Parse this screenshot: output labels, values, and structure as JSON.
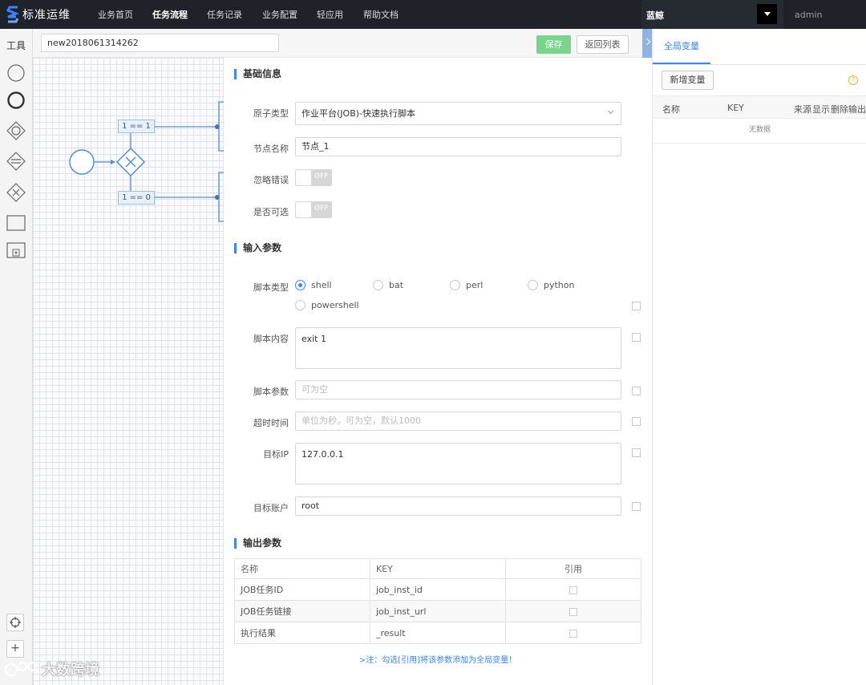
{
  "brand": {
    "name": "标准运维"
  },
  "nav": {
    "items": [
      "业务首页",
      "任务流程",
      "任务记录",
      "业务配置",
      "轻应用",
      "帮助文档"
    ],
    "business": "蓝鲸",
    "user": "admin"
  },
  "toolbar": {
    "title": "工具"
  },
  "header": {
    "flow_name": "new2018061314262",
    "save_label": "保存",
    "back_label": "返回列表"
  },
  "canvas": {
    "cond_top": "1 == 1",
    "cond_bottom": "1 == 0"
  },
  "basic": {
    "title": "基础信息",
    "atom_type_label": "原子类型",
    "atom_type_value": "作业平台(JOB)-快速执行脚本",
    "node_name_label": "节点名称",
    "node_name_value": "节点_1",
    "ignore_error_label": "忽略错误",
    "ignore_error_state": "OFF",
    "optional_label": "是否可选",
    "optional_state": "OFF"
  },
  "input": {
    "title": "输入参数",
    "script_type_label": "脚本类型",
    "script_types": [
      "shell",
      "bat",
      "perl",
      "python",
      "powershell"
    ],
    "selected_script_type": "shell",
    "script_content_label": "脚本内容",
    "script_content_value": "exit 1",
    "script_params_label": "脚本参数",
    "script_params_placeholder": "可为空",
    "timeout_label": "超时时间",
    "timeout_placeholder": "单位为秒，可为空，默认1000",
    "target_ip_label": "目标IP",
    "target_ip_value": "127.0.0.1",
    "target_account_label": "目标账户",
    "target_account_value": "root"
  },
  "output": {
    "title": "输出参数",
    "headers": [
      "名称",
      "KEY",
      "引用"
    ],
    "rows": [
      {
        "name": "JOB任务ID",
        "key": "job_inst_id"
      },
      {
        "name": "JOB任务链接",
        "key": "job_inst_url"
      },
      {
        "name": "执行结果",
        "key": "_result"
      }
    ],
    "note": ">注：勾选[引用]将该参数添加为全局变量！"
  },
  "global_vars": {
    "tab_label": "全局变量",
    "add_label": "新增变量",
    "headers": [
      "名称",
      "KEY",
      "来源",
      "显示",
      "删除",
      "输出"
    ],
    "empty_text": "无数据"
  },
  "watermark": {
    "text": "大数跨境"
  },
  "colors": {
    "accent": "#3a84ff",
    "save_green": "#79d48c",
    "nav_bg": "#1f2228"
  }
}
